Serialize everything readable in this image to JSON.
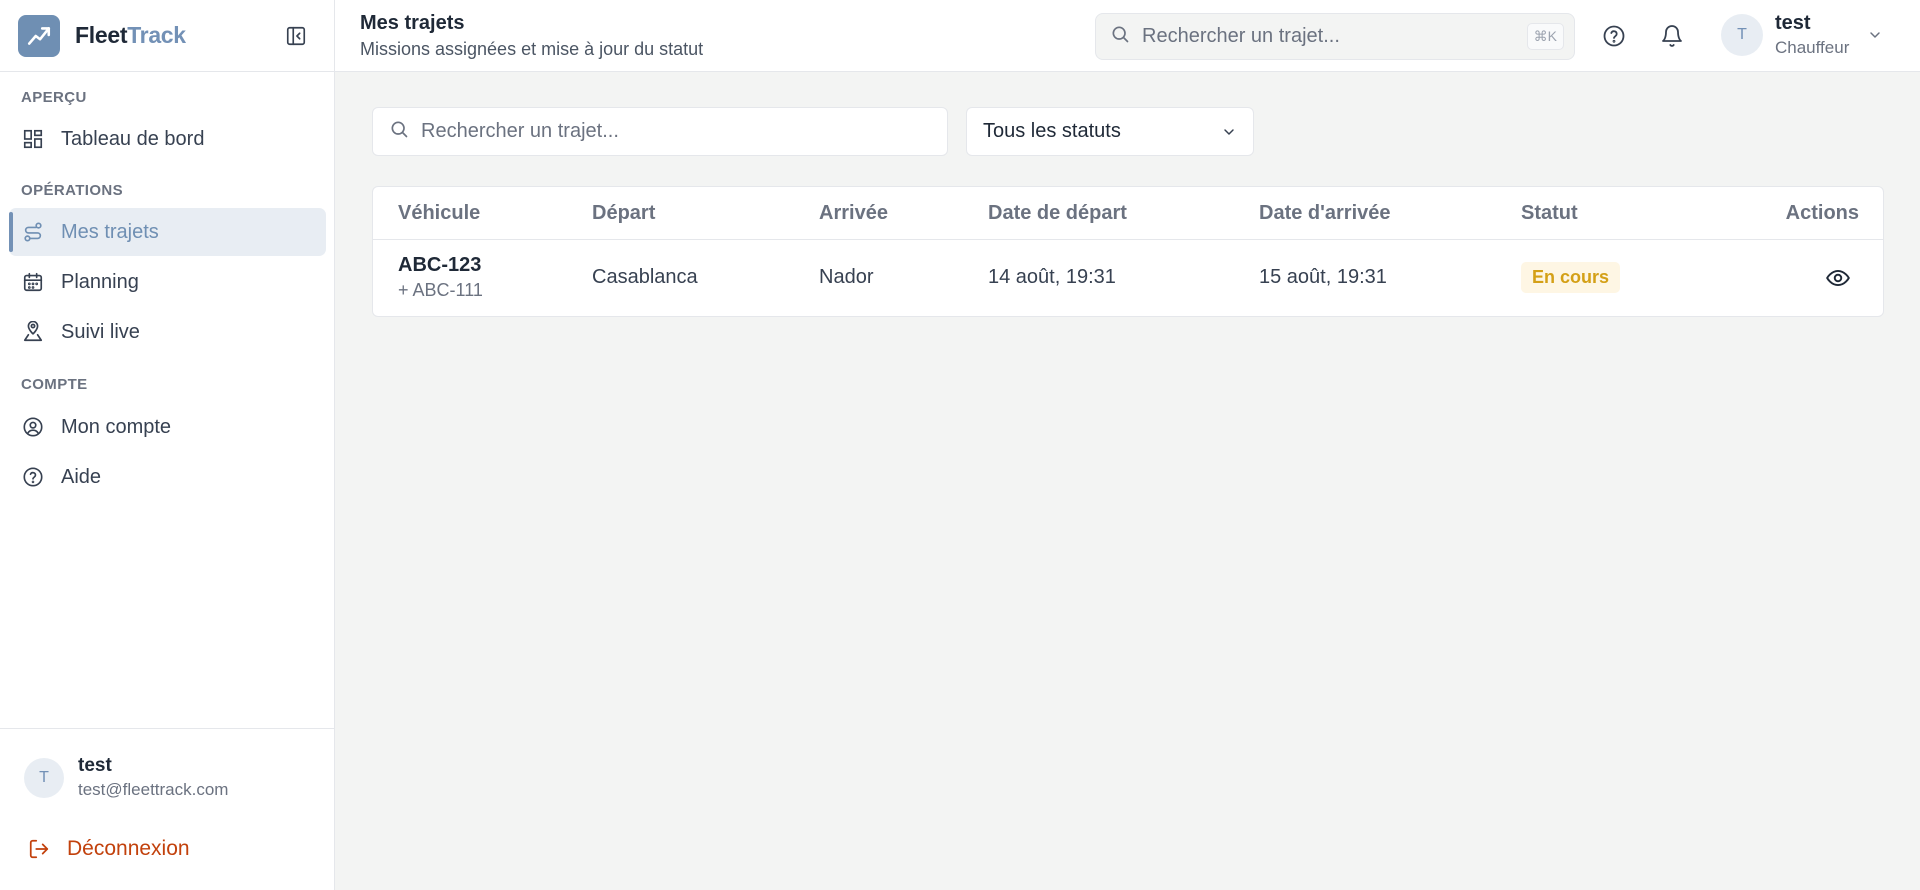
{
  "brand": {
    "part1": "Fleet",
    "part2": "Track"
  },
  "sidebar": {
    "sections": [
      {
        "label": "APERÇU"
      },
      {
        "label": "OPÉRATIONS"
      },
      {
        "label": "COMPTE"
      }
    ],
    "items": [
      {
        "label": "Tableau de bord",
        "icon": "dashboard-grid-icon"
      },
      {
        "label": "Mes trajets",
        "icon": "route-icon",
        "active": true
      },
      {
        "label": "Planning",
        "icon": "calendar-icon"
      },
      {
        "label": "Suivi live",
        "icon": "location-pin-icon"
      },
      {
        "label": "Mon compte",
        "icon": "user-circle-icon"
      },
      {
        "label": "Aide",
        "icon": "help-circle-icon"
      }
    ],
    "user": {
      "initial": "T",
      "name": "test",
      "email": "test@fleettrack.com"
    },
    "logout_label": "Déconnexion"
  },
  "header": {
    "title": "Mes trajets",
    "subtitle": "Missions assignées et mise à jour du statut",
    "search_placeholder": "Rechercher un trajet...",
    "shortcut": "⌘K",
    "user": {
      "initial": "T",
      "name": "test",
      "role": "Chauffeur"
    }
  },
  "filters": {
    "search_placeholder": "Rechercher un trajet...",
    "status_selected": "Tous les statuts"
  },
  "table": {
    "columns": [
      "Véhicule",
      "Départ",
      "Arrivée",
      "Date de départ",
      "Date d'arrivée",
      "Statut",
      "Actions"
    ],
    "rows": [
      {
        "vehicle": "ABC-123",
        "trailer": "+ ABC-111",
        "departure": "Casablanca",
        "arrival": "Nador",
        "departure_date": "14 août, 19:31",
        "arrival_date": "15 août, 19:31",
        "status": "En cours"
      }
    ]
  },
  "colors": {
    "accent": "#7391b6",
    "logout": "#c2410c",
    "status_in_progress_bg": "#fef6e4",
    "status_in_progress_text": "#d4a017"
  }
}
